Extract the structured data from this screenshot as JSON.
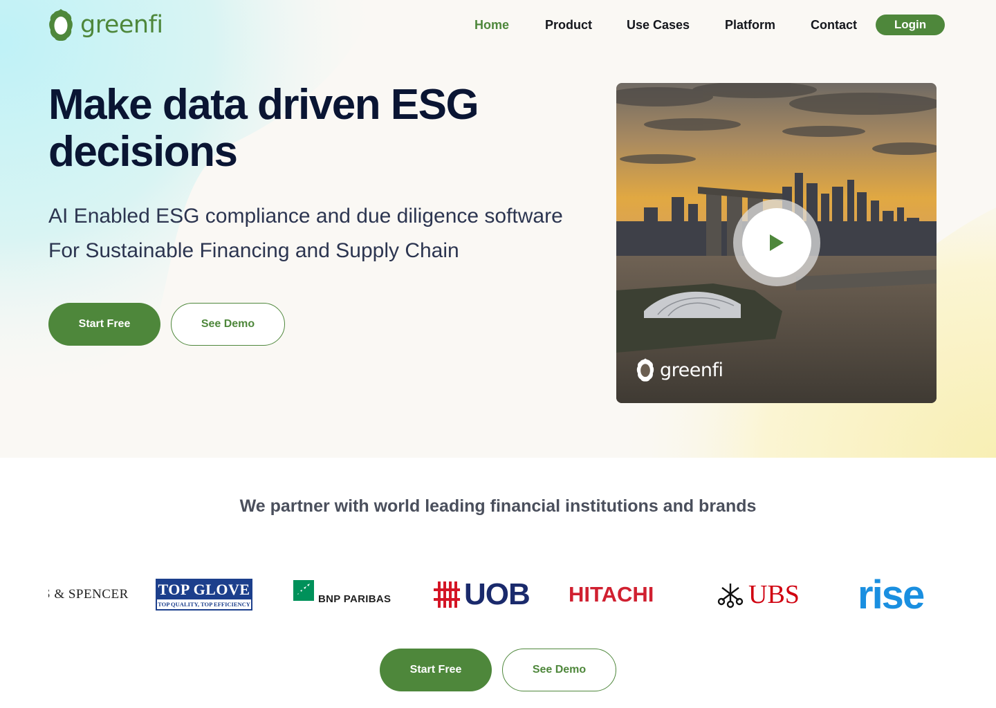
{
  "brand": {
    "name": "greenfi",
    "color": "#4e873b"
  },
  "nav": {
    "items": [
      {
        "label": "Home",
        "active": true
      },
      {
        "label": "Product",
        "active": false
      },
      {
        "label": "Use Cases",
        "active": false
      },
      {
        "label": "Platform",
        "active": false
      },
      {
        "label": "Contact",
        "active": false
      }
    ],
    "login_label": "Login"
  },
  "hero": {
    "title": "Make data driven ESG decisions",
    "subtitle": "AI Enabled ESG compliance and due diligence software For Sustainable Financing and Supply Chain",
    "start_free_label": "Start Free",
    "see_demo_label": "See Demo",
    "video": {
      "watermark": "greenfi",
      "play_icon": "play-icon"
    }
  },
  "partners": {
    "title": "We partner with world leading financial institutions and brands",
    "logos": {
      "marks_spencer": "S & SPENCER",
      "top_glove": "TOP GLOVE",
      "top_glove_tagline": "TOP QUALITY, TOP EFFICIENCY",
      "bnp_paribas": "BNP PARIBAS",
      "uob": "UOB",
      "hitachi": "HITACHI",
      "ubs": "UBS",
      "rise": "rise"
    },
    "start_free_label": "Start Free",
    "see_demo_label": "See Demo"
  },
  "colors": {
    "primary_green": "#4e873b",
    "heading_navy": "#0a1533",
    "hero_bg": "#faf8f4",
    "hero_gradient_cyan": "#c3f1f6",
    "hero_gradient_yellow": "#fbf4c6"
  }
}
